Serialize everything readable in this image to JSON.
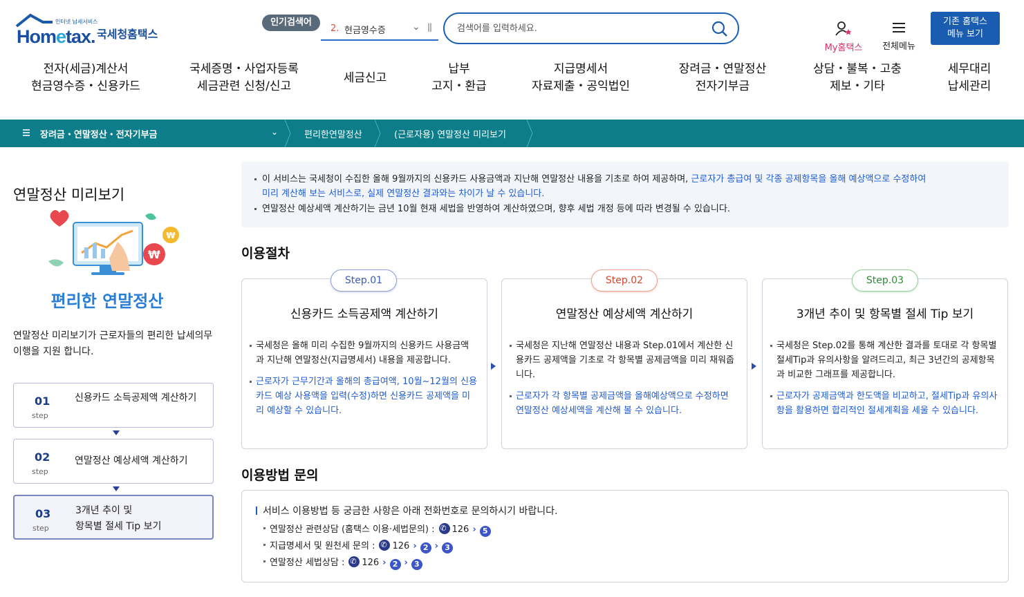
{
  "header": {
    "logo_small": "인터넷 납세서비스",
    "logo_main_a": "Hom",
    "logo_main_e": "e",
    "logo_main_b": "tax.",
    "logo_sub": "국세청홈택스",
    "popular_badge": "인기검색어",
    "popular_rank": "2.",
    "popular_term": "현금영수증",
    "search_placeholder": "검색어를 입력하세요.",
    "my_hometax": "My홈택스",
    "all_menu": "전체메뉴",
    "old_menu_line1": "기존 홈택스",
    "old_menu_line2": "메뉴 보기"
  },
  "gnb": [
    {
      "line1": "전자(세금)계산서",
      "line2": "현금영수증・신용카드"
    },
    {
      "line1": "국세증명・사업자등록",
      "line2": "세금관련 신청/신고"
    },
    {
      "line1": "세금신고",
      "line2": ""
    },
    {
      "line1": "납부",
      "line2": "고지・환급"
    },
    {
      "line1": "지급명세서",
      "line2": "자료제출・공익법인"
    },
    {
      "line1": "장려금・연말정산",
      "line2": "전자기부금"
    },
    {
      "line1": "상담・불복・고충",
      "line2": "제보・기타"
    },
    {
      "line1": "세무대리",
      "line2": "납세관리"
    }
  ],
  "breadcrumb": {
    "first": "장려금・연말정산・전자기부금",
    "second": "편리한연말정산",
    "third": "(근로자용) 연말정산 미리보기"
  },
  "sidebar": {
    "title": "연말정산 미리보기",
    "illust_caption": "편리한 연말정산",
    "desc": "연말정산 미리보기가 근로자들의  편리한 납세의무 이행을 지원 합니다.",
    "steps": [
      {
        "num": "01",
        "step": "step",
        "label": "신용카드 소득공제액 계산하기"
      },
      {
        "num": "02",
        "step": "step",
        "label": "연말정산 예상세액 계산하기"
      },
      {
        "num": "03",
        "step": "step",
        "label_line1": "3개년 추이 및",
        "label_line2": "항목별 절세 Tip 보기"
      }
    ]
  },
  "notice": {
    "line1_a": "이 서비스는 국세청이 수집한 올해 9월까지의 신용카드 사용금액과 지난해 연말정산 내용을 기초로 하여 제공하며, ",
    "line1_b": "근로자가 총급여 및 각종 공제항목을 올해 예상액으로 수정하여",
    "line1_c": "미리 계산해 보는 서비스로, 실제 연말정산 결과와는 차이가 날 수 있습니다.",
    "line2": "연말정산 예상세액 계산하기는 금년 10월 현재 세법을 반영하여 계산하였으며, 향후 세법 개정 등에 따라 변경될 수 있습니다."
  },
  "procedure": {
    "title": "이용절차",
    "steps": [
      {
        "pill": "Step.01",
        "title": "신용카드 소득공제액 계산하기",
        "text1": "국세청은 올해 미리 수집한 9월까지의 신용카드 사용금액과 지난해 연말정산(지급명세서) 내용을 제공합니다.",
        "text2": "근로자가 근무기간과 올해의 총급여액, 10월~12월의 신용카드 예상 사용액을 입력(수정)하면 신용카드 공제액을 미리 예상할 수 있습니다."
      },
      {
        "pill": "Step.02",
        "title": "연말정산 예상세액 계산하기",
        "text1": "국세청은 지난해 연말정산 내용과 Step.01에서 계산한 신용카드 공제액을 기초로 각 항목별 공제금액을 미리 채워줍니다.",
        "text2": "근로자가 각 항목별 공제금액을 올해예상액으로 수정하면 연말정산 예상세액을 계산해 볼 수 있습니다."
      },
      {
        "pill": "Step.03",
        "title": "3개년 추이 및 항목별 절세 Tip 보기",
        "text1": "국세청은 Step.02를 통해 계산한 결과를 토대로 각 항목별 절세Tip과 유의사항을 알려드리고, 최근 3년간의 공제항목과 비교한 그래프를 제공합니다.",
        "text2": "근로자가 공제금액과 한도액을 비교하고, 절세Tip과 유의사항을 활용하면 합리적인 절세계획을 세울 수 있습니다."
      }
    ]
  },
  "inquiry": {
    "title": "이용방법 문의",
    "head": "서비스 이용방법 등 궁금한 사항은 아래 전화번호로 문의하시기 바랍니다.",
    "lines": [
      {
        "label": "연말정산 관련상담 (홈택스 이용·세법문의) :",
        "phone": "126",
        "n1": "5",
        "n2": ""
      },
      {
        "label": "지급명세서 및 원천세 문의 :",
        "phone": "126",
        "n1": "2",
        "n2": "3"
      },
      {
        "label": "연말정산 세법상담 :",
        "phone": "126",
        "n1": "2",
        "n2": "3"
      }
    ]
  },
  "colors": {
    "primary": "#1a5cb0",
    "breadcrumb_bg": "#0d7d8a",
    "link_blue": "#1d5bd4",
    "step1": "#3c5bb5",
    "step2": "#d6452a",
    "step3": "#2f8a3a"
  }
}
